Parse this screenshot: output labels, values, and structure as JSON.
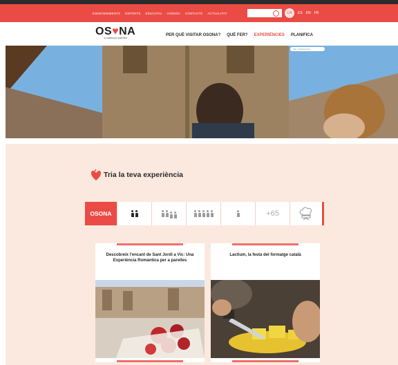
{
  "topbar": {
    "links": [
      "Esdeveniments",
      "Esports",
      "Educatiu",
      "Agenda",
      "Contacte",
      "Actualitat"
    ],
    "languages": [
      "CA",
      "ES",
      "EN",
      "FR"
    ],
    "active_language": "CA"
  },
  "header": {
    "logo_text_left": "OS",
    "logo_text_heart": "♥",
    "logo_text_right": "NA",
    "logo_tagline": "la catalunya autèntica",
    "nav": [
      "Per què visitar Osona?",
      "Què fer?",
      "Experiències",
      "Planifica"
    ],
    "active_nav": "Experiències"
  },
  "hero": {
    "breadcrumb": "Inici / Experiències"
  },
  "section": {
    "title": "Tria la teva experiència"
  },
  "filters": {
    "logo": "OSONA",
    "plus": "+65"
  },
  "cards": [
    {
      "title": "Descobreix l'encant de Sant Jordi a Vic: Una Experiència Romàntica per a parelles"
    },
    {
      "title": "Lactium, la festa del formatge català"
    }
  ],
  "colors": {
    "accent": "#ea4c45",
    "background": "#fbe9df",
    "dark": "#2b2b2b"
  }
}
